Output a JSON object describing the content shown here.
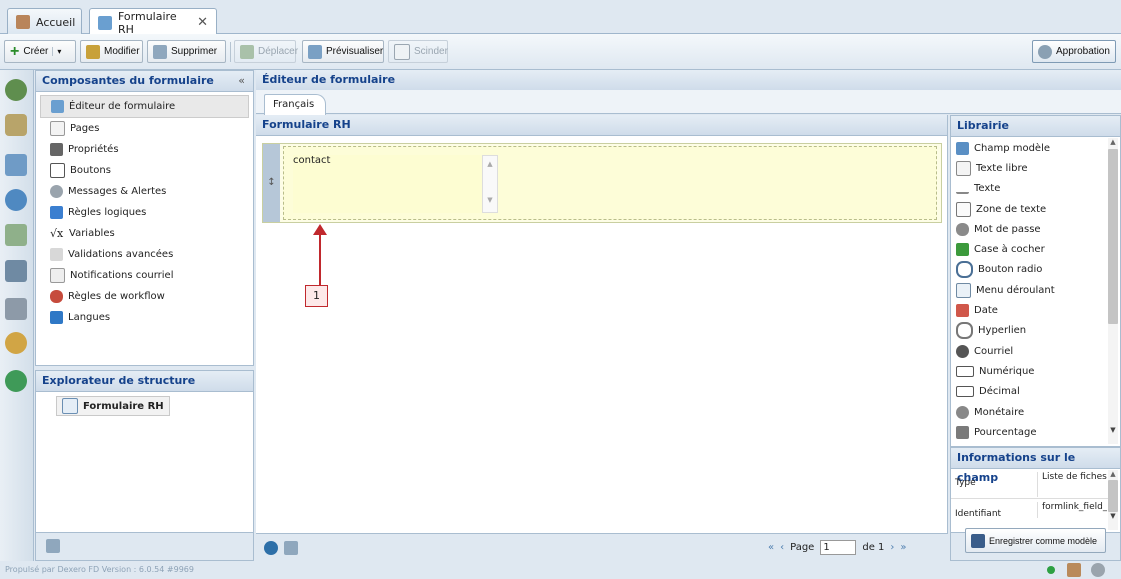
{
  "tabs": [
    {
      "label": "Accueil",
      "icon": "home-icon"
    },
    {
      "label": "Formulaire RH",
      "icon": "form-edit-icon",
      "active": true
    }
  ],
  "toolbar": {
    "create": "Créer",
    "modify": "Modifier",
    "delete": "Supprimer",
    "move": "Déplacer",
    "preview": "Prévisualiser",
    "split": "Scinder",
    "approval": "Approbation"
  },
  "components": {
    "title": "Composantes du formulaire",
    "collapse": "«",
    "items": [
      {
        "label": "Éditeur de formulaire",
        "icon": "form-editor-icon",
        "selected": true
      },
      {
        "label": "Pages",
        "icon": "pages-icon"
      },
      {
        "label": "Propriétés",
        "icon": "properties-icon"
      },
      {
        "label": "Boutons",
        "icon": "buttons-icon"
      },
      {
        "label": "Messages & Alertes",
        "icon": "messages-icon"
      },
      {
        "label": "Règles logiques",
        "icon": "logic-rules-icon"
      },
      {
        "label": "Variables",
        "icon": "variables-icon"
      },
      {
        "label": "Validations avancées",
        "icon": "validation-icon"
      },
      {
        "label": "Notifications courriel",
        "icon": "email-notification-icon"
      },
      {
        "label": "Règles de workflow",
        "icon": "workflow-icon"
      },
      {
        "label": "Langues",
        "icon": "languages-icon"
      }
    ]
  },
  "structure": {
    "title": "Explorateur de structure",
    "node": "Formulaire RH"
  },
  "editor": {
    "title": "Éditeur de formulaire",
    "language_tab": "Français",
    "form_title": "Formulaire RH",
    "field_value": "contact",
    "callout": "1",
    "pager": {
      "page_label": "Page",
      "page_value": "1",
      "of_label": "de 1"
    }
  },
  "library": {
    "title": "Librairie",
    "items": [
      {
        "label": "Champ modèle",
        "icon": "template-field-icon"
      },
      {
        "label": "Texte libre",
        "icon": "free-text-icon"
      },
      {
        "label": "Texte",
        "icon": "text-icon"
      },
      {
        "label": "Zone de texte",
        "icon": "textarea-icon"
      },
      {
        "label": "Mot de passe",
        "icon": "password-icon"
      },
      {
        "label": "Case à cocher",
        "icon": "checkbox-icon"
      },
      {
        "label": "Bouton radio",
        "icon": "radio-icon"
      },
      {
        "label": "Menu déroulant",
        "icon": "dropdown-icon"
      },
      {
        "label": "Date",
        "icon": "date-icon"
      },
      {
        "label": "Hyperlien",
        "icon": "hyperlink-icon"
      },
      {
        "label": "Courriel",
        "icon": "email-icon"
      },
      {
        "label": "Numérique",
        "icon": "numeric-icon"
      },
      {
        "label": "Décimal",
        "icon": "decimal-icon"
      },
      {
        "label": "Monétaire",
        "icon": "currency-icon"
      },
      {
        "label": "Pourcentage",
        "icon": "percentage-icon"
      }
    ]
  },
  "field_info": {
    "title": "Informations sur le champ",
    "rows": [
      {
        "key": "Type",
        "value": "Liste de fiches"
      },
      {
        "key": "Identifiant",
        "value": "formlink_field_"
      }
    ],
    "save_template": "Enregistrer comme modèle"
  },
  "footer": {
    "text": "Propulsé par Dexero FD Version : 6.0.54 #9969"
  }
}
